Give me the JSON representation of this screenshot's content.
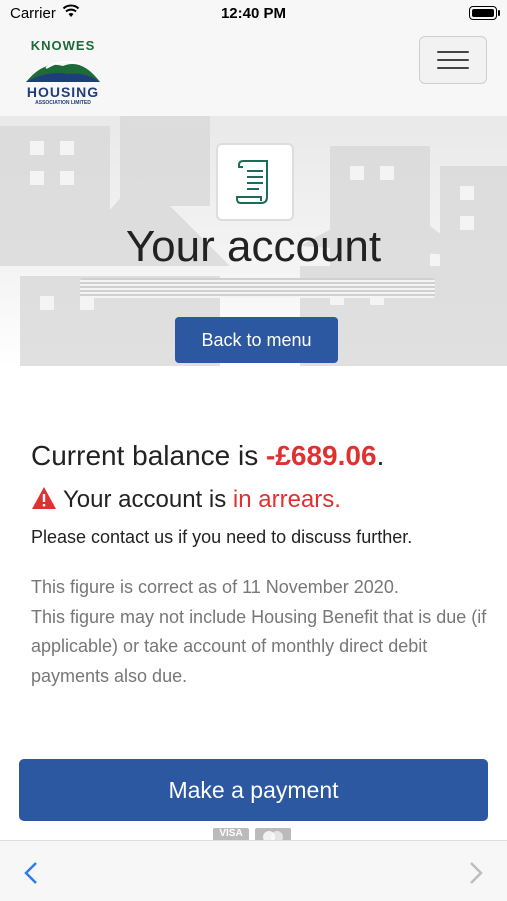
{
  "status_bar": {
    "carrier": "Carrier",
    "time": "12:40 PM"
  },
  "header": {
    "logo": {
      "top_word": "KNOWES",
      "main_word": "HOUSING",
      "sub_text": "ASSOCIATION LIMITED"
    },
    "menu_icon": "hamburger-menu-icon"
  },
  "hero": {
    "icon": "document-scroll-icon",
    "title": "Your account",
    "back_label": "Back to menu"
  },
  "account": {
    "balance_prefix": "Current balance is ",
    "balance_amount": "-£689.06",
    "balance_suffix": ".",
    "arrears_prefix": "Your account is ",
    "arrears_status": "in arrears",
    "arrears_suffix": ".",
    "contact_text": "Please contact us if you need to discuss further.",
    "note_line1": "This figure is correct as of 11 November 2020.",
    "note_line2": "This figure may not include Housing Benefit that is due (if applicable) or take account of monthly direct debit payments also due."
  },
  "payment": {
    "button_label": "Make a payment",
    "card_visa": "VISA"
  },
  "colors": {
    "primary": "#2b58a0",
    "alert": "#e03131",
    "logo_green": "#1e6b3a",
    "logo_blue": "#1f3d7a"
  }
}
